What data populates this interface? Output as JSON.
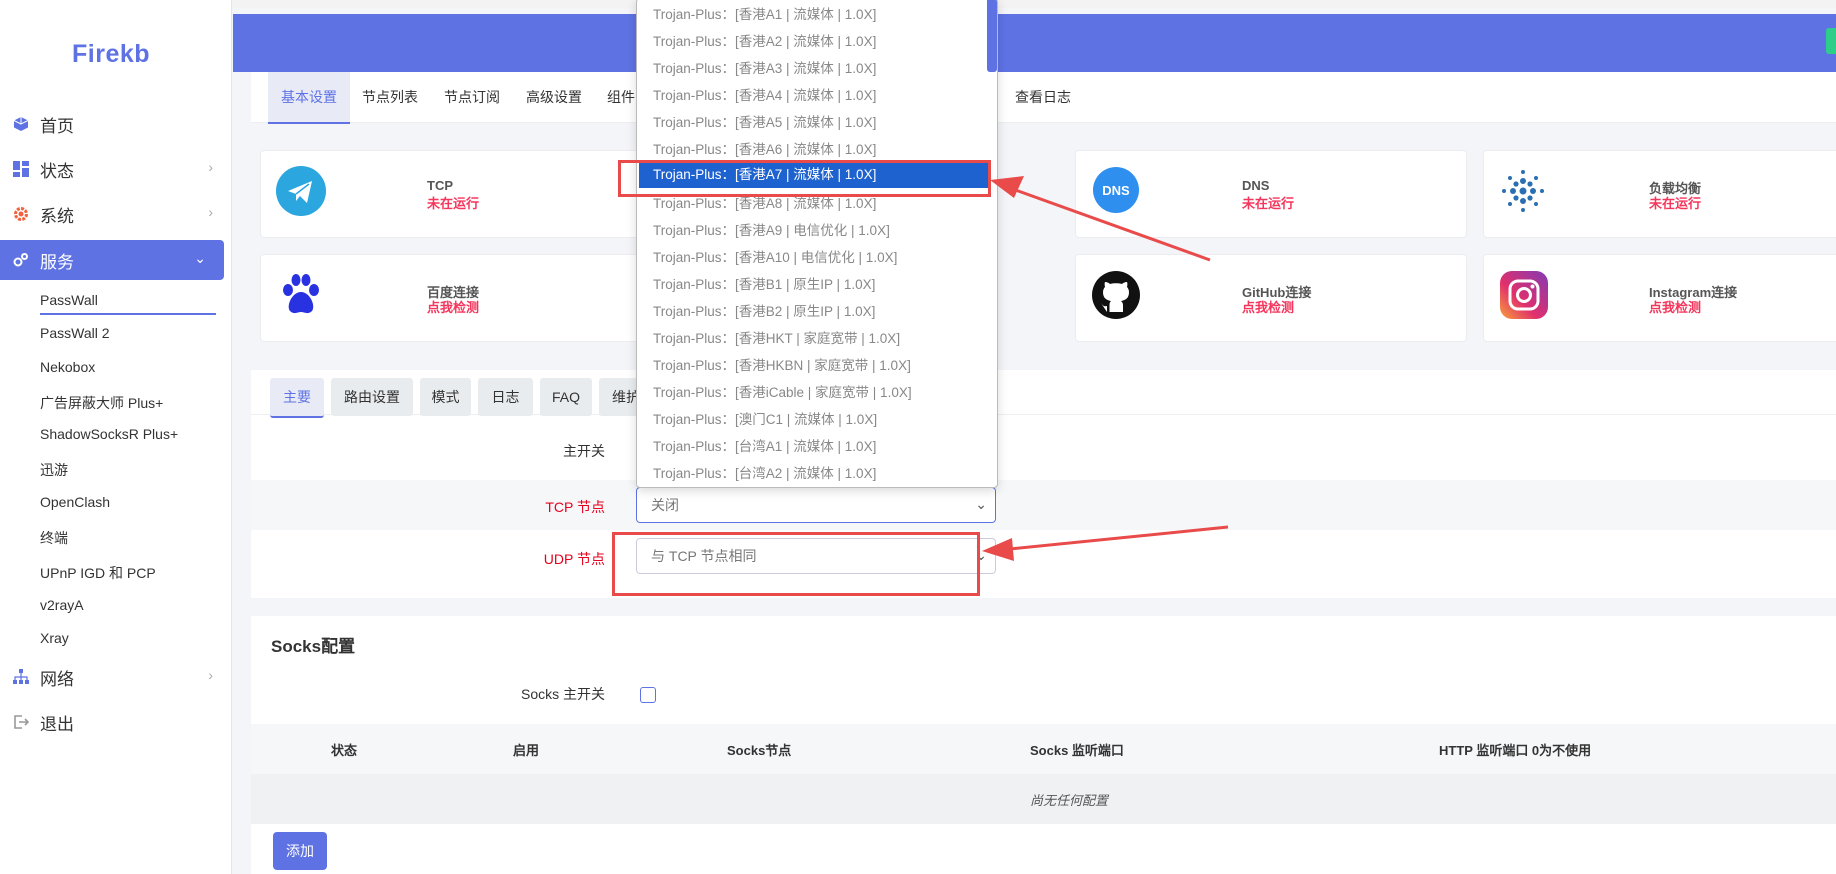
{
  "sidebar": {
    "logo": "Firekb",
    "nav": [
      {
        "label": "首页",
        "icon": "cube-icon"
      },
      {
        "label": "状态",
        "icon": "dashboard-icon"
      },
      {
        "label": "系统",
        "icon": "gear-icon"
      },
      {
        "label": "服务",
        "icon": "cogs-icon"
      },
      {
        "label": "网络",
        "icon": "network-icon"
      },
      {
        "label": "退出",
        "icon": "logout-icon"
      }
    ],
    "services": [
      "PassWall",
      "PassWall 2",
      "Nekobox",
      "广告屏蔽大师 Plus+",
      "ShadowSocksR Plus+",
      "迅游",
      "OpenClash",
      "终端",
      "UPnP IGD 和 PCP",
      "v2rayA",
      "Xray"
    ]
  },
  "tabs": [
    "基本设置",
    "节点列表",
    "节点订阅",
    "高级设置",
    "组件",
    "查看日志"
  ],
  "cards": [
    {
      "title": "TCP",
      "status": "未在运行",
      "icon": "telegram-icon"
    },
    {
      "title": "DNS",
      "status": "未在运行",
      "icon": "dns-icon"
    },
    {
      "title": "负载均衡",
      "status": "未在运行",
      "icon": "load-balance-icon"
    },
    {
      "title": "百度连接",
      "status": "点我检测",
      "icon": "baidu-paw-icon"
    },
    {
      "title": "GitHub连接",
      "status": "点我检测",
      "icon": "github-icon"
    },
    {
      "title": "Instagram连接",
      "status": "点我检测",
      "icon": "instagram-icon"
    }
  ],
  "subtabs": [
    "主要",
    "路由设置",
    "模式",
    "日志",
    "FAQ",
    "维护"
  ],
  "form": {
    "main_switch_label": "主开关",
    "tcp_label": "TCP 节点",
    "tcp_value": "关闭",
    "udp_label": "UDP 节点",
    "udp_value": "与 TCP 节点相同"
  },
  "dropdown": {
    "selected_index": 6,
    "options": [
      "Trojan-Plus：[香港A1 | 流媒体 | 1.0X]",
      "Trojan-Plus：[香港A2 | 流媒体 | 1.0X]",
      "Trojan-Plus：[香港A3 | 流媒体 | 1.0X]",
      "Trojan-Plus：[香港A4 | 流媒体 | 1.0X]",
      "Trojan-Plus：[香港A5 | 流媒体 | 1.0X]",
      "Trojan-Plus：[香港A6 | 流媒体 | 1.0X]",
      "Trojan-Plus：[香港A7 | 流媒体 | 1.0X]",
      "Trojan-Plus：[香港A8 | 流媒体 | 1.0X]",
      "Trojan-Plus：[香港A9 | 电信优化 | 1.0X]",
      "Trojan-Plus：[香港A10 | 电信优化 | 1.0X]",
      "Trojan-Plus：[香港B1 | 原生IP | 1.0X]",
      "Trojan-Plus：[香港B2 | 原生IP | 1.0X]",
      "Trojan-Plus：[香港HKT | 家庭宽带 | 1.0X]",
      "Trojan-Plus：[香港HKBN | 家庭宽带 | 1.0X]",
      "Trojan-Plus：[香港iCable | 家庭宽带 | 1.0X]",
      "Trojan-Plus：[澳门C1 | 流媒体 | 1.0X]",
      "Trojan-Plus：[台湾A1 | 流媒体 | 1.0X]",
      "Trojan-Plus：[台湾A2 | 流媒体 | 1.0X]"
    ]
  },
  "socks": {
    "title": "Socks配置",
    "switch_label": "Socks 主开关",
    "columns": [
      "状态",
      "启用",
      "Socks节点",
      "Socks 监听端口",
      "HTTP 监听端口 0为不使用"
    ],
    "empty_text": "尚无任何配置",
    "add_button": "添加"
  },
  "colors": {
    "accent": "#5e72e4",
    "danger": "#f5365c",
    "annotation": "#e94b4b",
    "selected": "#1e62d0"
  }
}
